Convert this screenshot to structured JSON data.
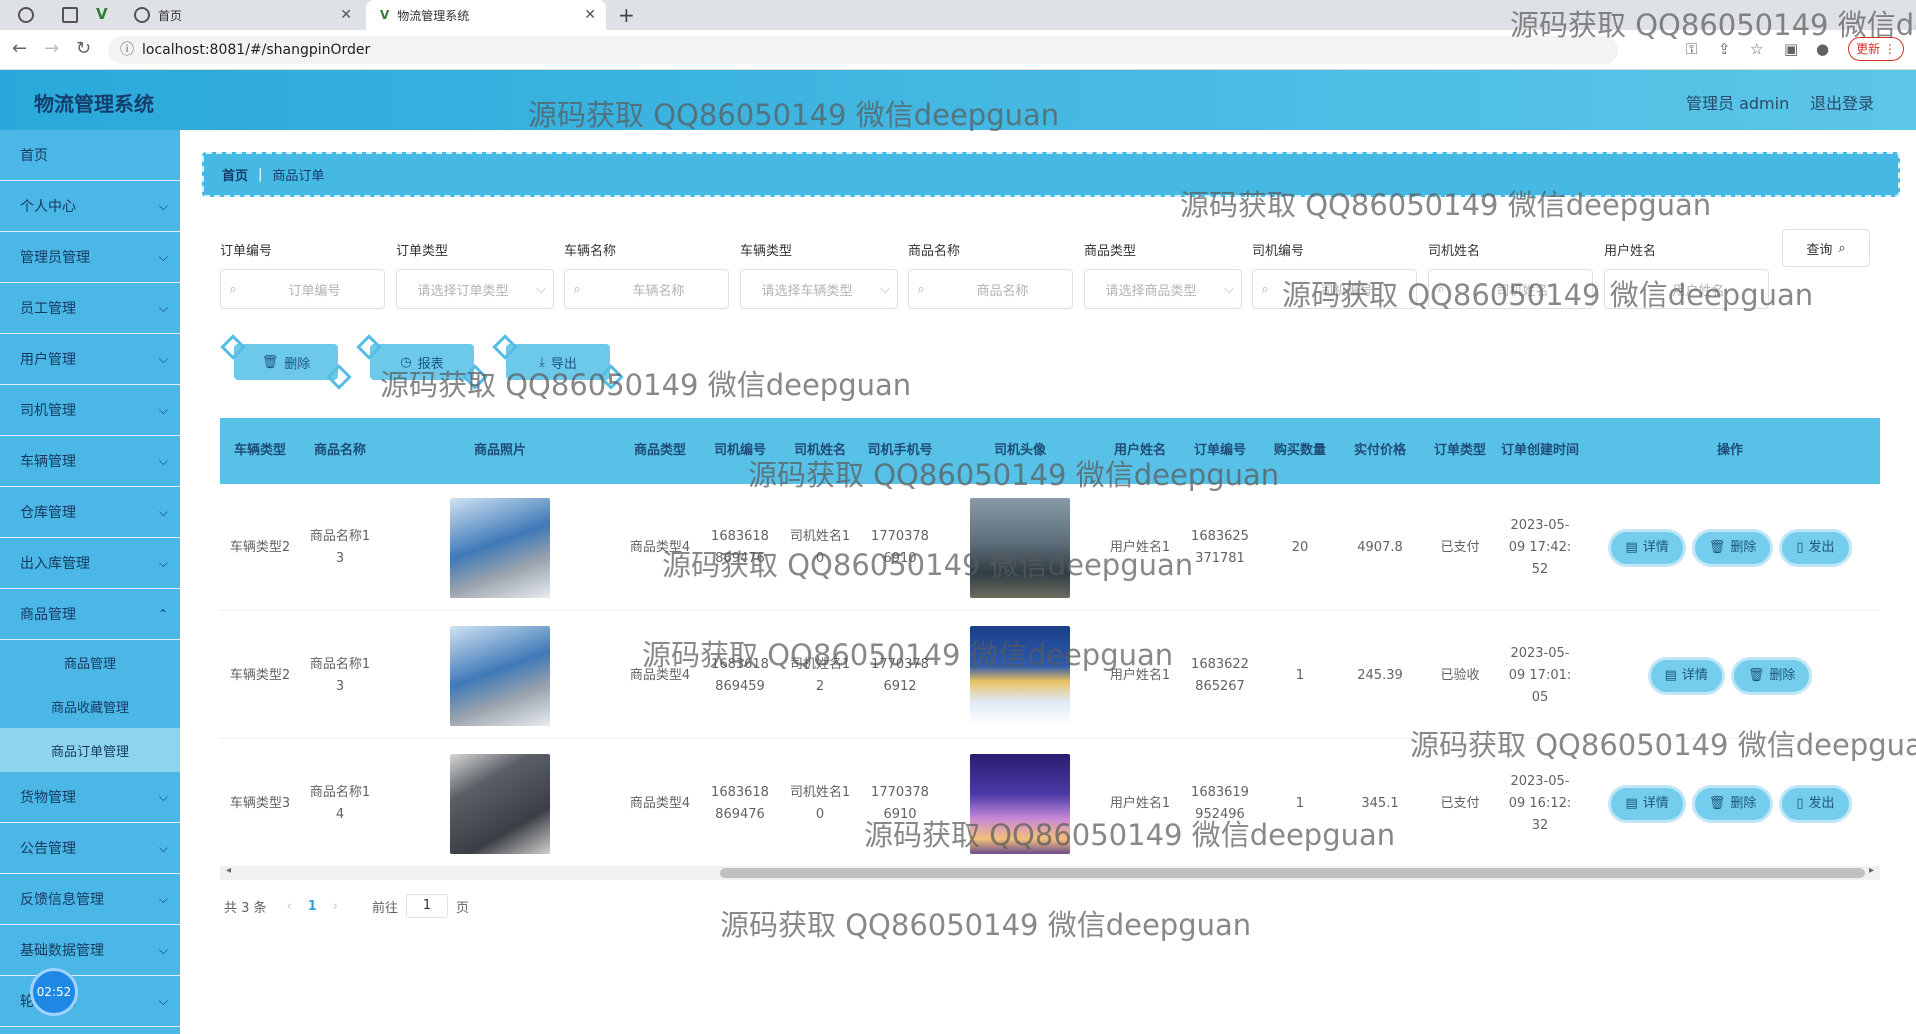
{
  "browser": {
    "tabs": [
      {
        "label": "首页"
      },
      {
        "label": "物流管理系统"
      }
    ],
    "url": "localhost:8081/#/shangpinOrder",
    "update_label": "更新"
  },
  "header": {
    "title": "物流管理系统",
    "user_label": "管理员 admin",
    "logout_label": "退出登录"
  },
  "sidebar": {
    "items": [
      {
        "label": "首页"
      },
      {
        "label": "个人中心"
      },
      {
        "label": "管理员管理"
      },
      {
        "label": "员工管理"
      },
      {
        "label": "用户管理"
      },
      {
        "label": "司机管理"
      },
      {
        "label": "车辆管理"
      },
      {
        "label": "仓库管理"
      },
      {
        "label": "出入库管理"
      },
      {
        "label": "商品管理"
      }
    ],
    "sub_items": [
      {
        "label": "商品管理"
      },
      {
        "label": "商品收藏管理"
      },
      {
        "label": "商品订单管理"
      }
    ],
    "items_after": [
      {
        "label": "货物管理"
      },
      {
        "label": "公告管理"
      },
      {
        "label": "反馈信息管理"
      },
      {
        "label": "基础数据管理"
      },
      {
        "label": "轮播信息"
      }
    ],
    "timer": "02:52"
  },
  "breadcrumb": {
    "home": "首页",
    "current": "商品订单"
  },
  "search": {
    "fields": [
      {
        "label": "订单编号",
        "placeholder": "订单编号"
      },
      {
        "label": "订单类型",
        "placeholder": "请选择订单类型"
      },
      {
        "label": "车辆名称",
        "placeholder": "车辆名称"
      },
      {
        "label": "车辆类型",
        "placeholder": "请选择车辆类型"
      },
      {
        "label": "商品名称",
        "placeholder": "商品名称"
      },
      {
        "label": "商品类型",
        "placeholder": "请选择商品类型"
      },
      {
        "label": "司机编号",
        "placeholder": "司机编号"
      },
      {
        "label": "司机姓名",
        "placeholder": "司机姓名"
      },
      {
        "label": "用户姓名",
        "placeholder": "用户姓名"
      }
    ],
    "query_label": "查询"
  },
  "actions": {
    "delete": "删除",
    "report": "报表",
    "export": "导出"
  },
  "table": {
    "headers": [
      "车辆类型",
      "商品名称",
      "商品照片",
      "商品类型",
      "司机编号",
      "司机姓名",
      "司机手机号",
      "司机头像",
      "用户姓名",
      "订单编号",
      "购买数量",
      "实付价格",
      "订单类型",
      "订单创建时间",
      "操作"
    ],
    "rows": [
      {
        "vehicle_type": "车辆类型2",
        "product_name": "商品名称13",
        "product_type": "商品类型4",
        "driver_no": "1683618869476",
        "driver_name": "司机姓名10",
        "driver_phone": "17703786910",
        "user_name": "用户姓名1",
        "order_no": "1683625371781",
        "qty": "20",
        "price": "4907.8",
        "order_type": "已支付",
        "created": "2023-05-09 17:42:52",
        "ops": [
          "详情",
          "删除",
          "发出"
        ]
      },
      {
        "vehicle_type": "车辆类型2",
        "product_name": "商品名称13",
        "product_type": "商品类型4",
        "driver_no": "1683618869459",
        "driver_name": "司机姓名12",
        "driver_phone": "17703786912",
        "user_name": "用户姓名1",
        "order_no": "1683622865267",
        "qty": "1",
        "price": "245.39",
        "order_type": "已验收",
        "created": "2023-05-09 17:01:05",
        "ops": [
          "详情",
          "删除"
        ]
      },
      {
        "vehicle_type": "车辆类型3",
        "product_name": "商品名称14",
        "product_type": "商品类型4",
        "driver_no": "1683618869476",
        "driver_name": "司机姓名10",
        "driver_phone": "17703786910",
        "user_name": "用户姓名1",
        "order_no": "1683619952496",
        "qty": "1",
        "price": "345.1",
        "order_type": "已支付",
        "created": "2023-05-09 16:12:32",
        "ops": [
          "详情",
          "删除",
          "发出"
        ]
      }
    ]
  },
  "pagination": {
    "total": "共 3 条",
    "current": "1",
    "goto_label": "前往",
    "goto_value": "1",
    "page_unit": "页"
  },
  "watermark": "源码获取 QQ86050149 微信deepguan"
}
